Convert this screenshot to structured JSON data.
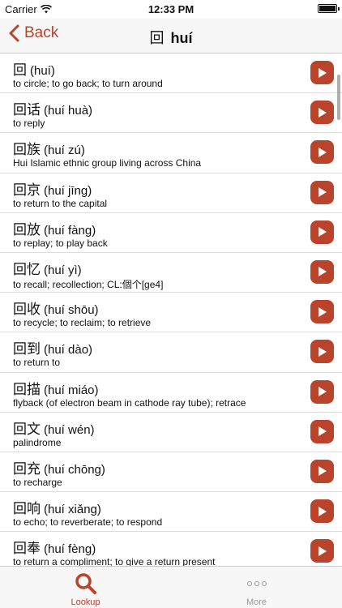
{
  "status": {
    "carrier": "Carrier",
    "time": "12:33 PM"
  },
  "nav": {
    "back_label": "Back",
    "title_hanzi": "回",
    "title_pinyin": "huí"
  },
  "entries": [
    {
      "hanzi": "回",
      "pinyin": "(huí)",
      "definition": "to circle; to go back; to turn around"
    },
    {
      "hanzi": "回话",
      "pinyin": "(huí huà)",
      "definition": "to reply"
    },
    {
      "hanzi": "回族",
      "pinyin": "(huí zú)",
      "definition": "Hui Islamic ethnic group living across China"
    },
    {
      "hanzi": "回京",
      "pinyin": "(huí jīng)",
      "definition": "to return to the capital"
    },
    {
      "hanzi": "回放",
      "pinyin": "(huí fàng)",
      "definition": "to replay; to play back"
    },
    {
      "hanzi": "回忆",
      "pinyin": "(huí yì)",
      "definition": "to recall; recollection; CL:個个[ge4]"
    },
    {
      "hanzi": "回收",
      "pinyin": "(huí shōu)",
      "definition": "to recycle; to reclaim; to retrieve"
    },
    {
      "hanzi": "回到",
      "pinyin": "(huí dào)",
      "definition": "to return to"
    },
    {
      "hanzi": "回描",
      "pinyin": "(huí miáo)",
      "definition": "flyback (of electron beam in cathode ray tube); retrace"
    },
    {
      "hanzi": "回文",
      "pinyin": "(huí wén)",
      "definition": "palindrome"
    },
    {
      "hanzi": "回充",
      "pinyin": "(huí chōng)",
      "definition": "to recharge"
    },
    {
      "hanzi": "回响",
      "pinyin": "(huí xiǎng)",
      "definition": "to echo; to reverberate; to respond"
    },
    {
      "hanzi": "回奉",
      "pinyin": "(huí fèng)",
      "definition": "to return a compliment; to give a return present"
    }
  ],
  "tabs": [
    {
      "label": "Lookup",
      "icon": "search-icon",
      "active": true
    },
    {
      "label": "More",
      "icon": "more-dots-icon",
      "active": false
    }
  ],
  "colors": {
    "accent": "#b9432b",
    "inactive": "#999999"
  }
}
